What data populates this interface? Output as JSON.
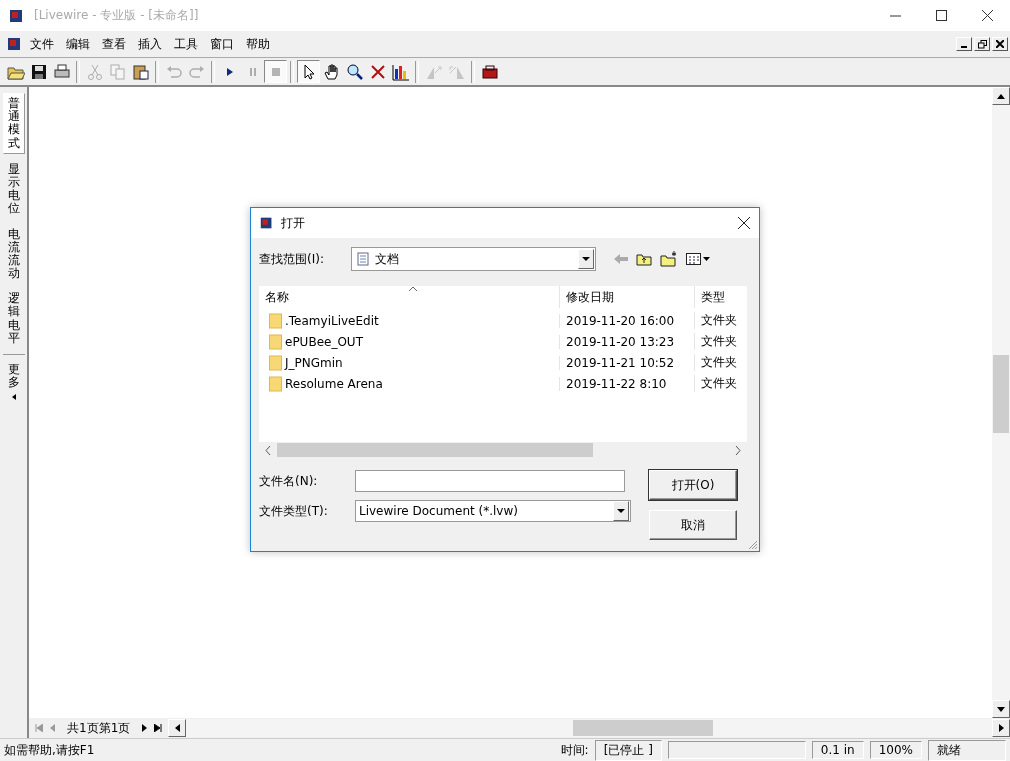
{
  "window": {
    "title": "[Livewire - 专业版 - [未命名]]"
  },
  "menu": [
    "文件",
    "编辑",
    "查看",
    "插入",
    "工具",
    "窗口",
    "帮助"
  ],
  "toolbar": [
    {
      "kind": "open",
      "disabled": false,
      "selected": false
    },
    {
      "kind": "save",
      "disabled": false,
      "selected": false
    },
    {
      "kind": "print",
      "disabled": false,
      "selected": false
    },
    {
      "kind": "sep"
    },
    {
      "kind": "cut",
      "disabled": true,
      "selected": false
    },
    {
      "kind": "copy",
      "disabled": true,
      "selected": false
    },
    {
      "kind": "paste",
      "disabled": false,
      "selected": false
    },
    {
      "kind": "sep"
    },
    {
      "kind": "undo",
      "disabled": true,
      "selected": false
    },
    {
      "kind": "redo",
      "disabled": true,
      "selected": false
    },
    {
      "kind": "sep"
    },
    {
      "kind": "play",
      "disabled": false,
      "selected": false
    },
    {
      "kind": "pause",
      "disabled": true,
      "selected": false
    },
    {
      "kind": "stop",
      "disabled": true,
      "selected": true
    },
    {
      "kind": "sep"
    },
    {
      "kind": "pointer",
      "disabled": false,
      "selected": true
    },
    {
      "kind": "hand",
      "disabled": false,
      "selected": false
    },
    {
      "kind": "zoom",
      "disabled": false,
      "selected": false
    },
    {
      "kind": "delete",
      "disabled": false,
      "selected": false
    },
    {
      "kind": "chart",
      "disabled": false,
      "selected": false
    },
    {
      "kind": "sep"
    },
    {
      "kind": "rotate-left",
      "disabled": true,
      "selected": false
    },
    {
      "kind": "rotate-right",
      "disabled": true,
      "selected": false
    },
    {
      "kind": "sep"
    },
    {
      "kind": "toolbox",
      "disabled": false,
      "selected": false
    }
  ],
  "mode_tabs": [
    {
      "label": "普通模式",
      "selected": true
    },
    {
      "label": "显示电位",
      "selected": false
    },
    {
      "label": "电流流动",
      "selected": false
    },
    {
      "label": "逻辑电平",
      "selected": false
    }
  ],
  "more_tab": {
    "label": "更多"
  },
  "page_nav": {
    "text": "共1页第1页"
  },
  "status_bar": {
    "help": "如需帮助,请按F1",
    "time_label": "时间:",
    "time_value": "[已停止 ]",
    "grid": "0.1 in",
    "zoom": "100%",
    "state": "就绪"
  },
  "dialog": {
    "title": "打开",
    "look_in_label": "查找范围(I):",
    "look_in_value": "文档",
    "columns": [
      "名称",
      "修改日期",
      "类型"
    ],
    "rows": [
      {
        "name": ".TeamyiLiveEdit",
        "date": "2019-11-20 16:00",
        "type": "文件夹"
      },
      {
        "name": "ePUBee_OUT",
        "date": "2019-11-20 13:23",
        "type": "文件夹"
      },
      {
        "name": "J_PNGmin",
        "date": "2019-11-21 10:52",
        "type": "文件夹"
      },
      {
        "name": "Resolume Arena",
        "date": "2019-11-22 8:10",
        "type": "文件夹"
      }
    ],
    "file_name_label": "文件名(N):",
    "file_type_label": "文件类型(T):",
    "file_type_value": "Livewire Document (*.lvw)",
    "buttons": [
      "打开(O)",
      "取消"
    ]
  }
}
